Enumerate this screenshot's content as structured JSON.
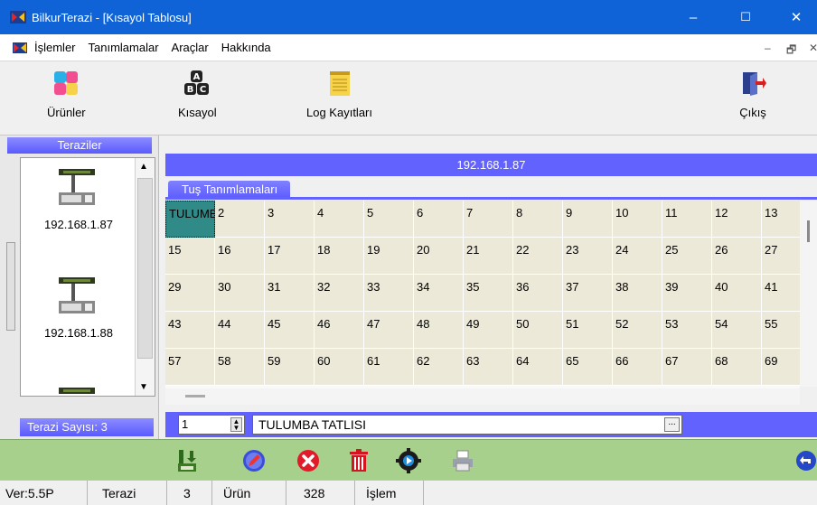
{
  "window": {
    "title": "BilkurTerazi  - [Kısayol Tablosu]",
    "minimize": "–",
    "maximize": "☐",
    "close": "✕"
  },
  "menu": {
    "items": [
      "İşlemler",
      "Tanımlamalar",
      "Araçlar",
      "Hakkında"
    ],
    "mdi_min": "–",
    "mdi_restore": "🗗",
    "mdi_close": "✕"
  },
  "toolbar": {
    "urunler": "Ürünler",
    "kisayol": "Kısayol",
    "log": "Log Kayıtları",
    "cikis": "Çıkış"
  },
  "scales_panel": {
    "header": "Teraziler",
    "items": [
      {
        "ip": "192.168.1.87"
      },
      {
        "ip": "192.168.1.88"
      }
    ],
    "footer": "Terazi Sayısı: 3"
  },
  "main": {
    "ip_header": "192.168.1.87",
    "tab": "Tuş Tanımlamaları",
    "grid": [
      [
        "TULUMBA",
        "2",
        "3",
        "4",
        "5",
        "6",
        "7",
        "8",
        "9",
        "10",
        "11",
        "12",
        "13"
      ],
      [
        "15",
        "16",
        "17",
        "18",
        "19",
        "20",
        "21",
        "22",
        "23",
        "24",
        "25",
        "26",
        "27"
      ],
      [
        "29",
        "30",
        "31",
        "32",
        "33",
        "34",
        "35",
        "36",
        "37",
        "38",
        "39",
        "40",
        "41"
      ],
      [
        "43",
        "44",
        "45",
        "46",
        "47",
        "48",
        "49",
        "50",
        "51",
        "52",
        "53",
        "54",
        "55"
      ],
      [
        "57",
        "58",
        "59",
        "60",
        "61",
        "62",
        "63",
        "64",
        "65",
        "66",
        "67",
        "68",
        "69"
      ]
    ],
    "spin_value": "1",
    "product_name": "TULUMBA TATLISI",
    "dots": "..."
  },
  "status": {
    "version": "Ver:5.5P",
    "terazi_label": "Terazi",
    "terazi_count": "3",
    "urun_label": "Ürün",
    "urun_count": "328",
    "islem_label": "İşlem"
  },
  "colors": {
    "titlebar": "#0f63d6",
    "panel_blue": "#6262ff",
    "action_green": "#a8d08d",
    "selected_cell": "#2f8a88"
  }
}
